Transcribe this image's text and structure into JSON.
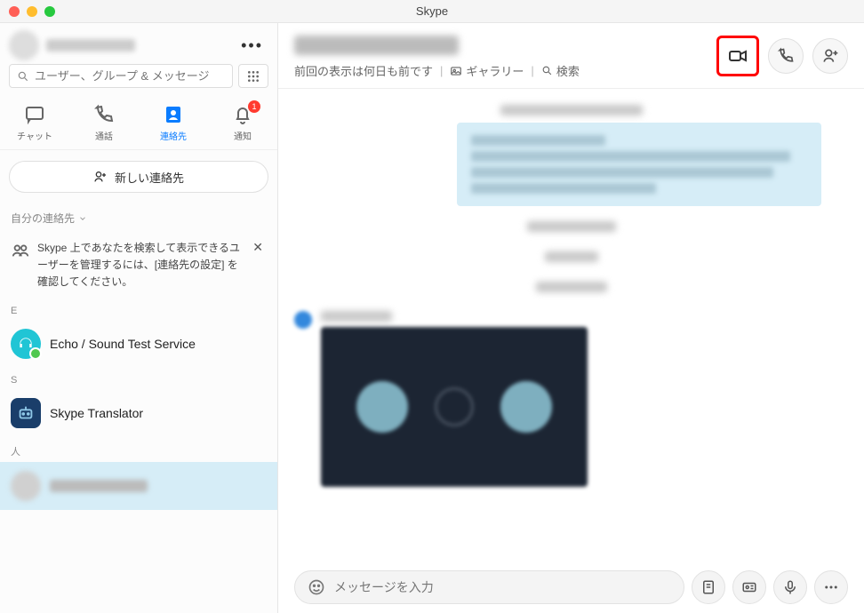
{
  "window": {
    "title": "Skype"
  },
  "sidebar": {
    "search_placeholder": "ユーザー、グループ & メッセージ",
    "tabs": {
      "chat": "チャット",
      "call": "通話",
      "contacts": "連絡先",
      "notifications": "通知",
      "notifications_badge": "1"
    },
    "new_contact_label": "新しい連絡先",
    "my_contacts_label": "自分の連絡先",
    "notice_text": "Skype 上であなたを検索して表示できるユーザーを管理するには、[連絡先の設定] を確認してください。",
    "sections": {
      "E": {
        "label": "E",
        "contacts": [
          {
            "name": "Echo / Sound Test Service"
          }
        ]
      },
      "S": {
        "label": "S",
        "contacts": [
          {
            "name": "Skype Translator"
          }
        ]
      },
      "people": {
        "label": "人"
      }
    }
  },
  "chat": {
    "subline_last_seen": "前回の表示は何日も前です",
    "gallery_label": "ギャラリー",
    "search_label": "検索"
  },
  "compose": {
    "placeholder": "メッセージを入力"
  }
}
